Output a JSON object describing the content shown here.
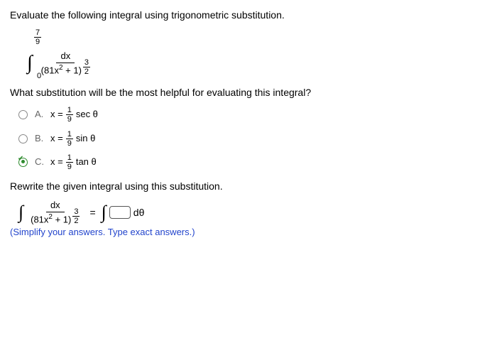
{
  "prompt1": "Evaluate the following integral using trigonometric substitution.",
  "integral_limits": {
    "upper_num": "7",
    "upper_den": "9",
    "lower": "0"
  },
  "integral_body": {
    "num": "dx",
    "den_base": "(81x",
    "den_sup": "2",
    "den_tail": " + 1)",
    "den_exp_num": "3",
    "den_exp_den": "2"
  },
  "prompt2": "What substitution will be the most helpful for evaluating this integral?",
  "choices": [
    {
      "label": "A.",
      "prefix": "x =",
      "frac_num": "1",
      "frac_den": "9",
      "func": "sec θ",
      "selected": false
    },
    {
      "label": "B.",
      "prefix": "x =",
      "frac_num": "1",
      "frac_den": "9",
      "func": "sin θ",
      "selected": false
    },
    {
      "label": "C.",
      "prefix": "x =",
      "frac_num": "1",
      "frac_den": "9",
      "func": "tan θ",
      "selected": true
    }
  ],
  "prompt3": "Rewrite the given integral using this substitution.",
  "rhs_tail": "dθ",
  "hint": "(Simplify your answers. Type exact answers.)"
}
